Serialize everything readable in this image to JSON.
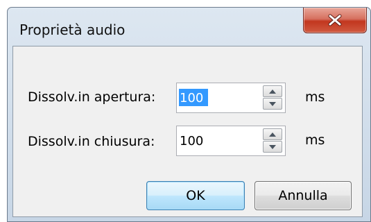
{
  "window": {
    "title": "Proprietà audio"
  },
  "fade_in": {
    "label": "Dissolv.in apertura:",
    "value": "100",
    "unit": "ms"
  },
  "fade_out": {
    "label": "Dissolv.in chiusura:",
    "value": "100",
    "unit": "ms"
  },
  "buttons": {
    "ok": "OK",
    "cancel": "Annulla"
  },
  "icons": {
    "close": "close-icon",
    "spin_up": "up-arrow-icon",
    "spin_down": "down-arrow-icon"
  },
  "colors": {
    "close_button": "#c7452c",
    "selection": "#3399ff",
    "default_button_border": "#3c7fb1"
  }
}
